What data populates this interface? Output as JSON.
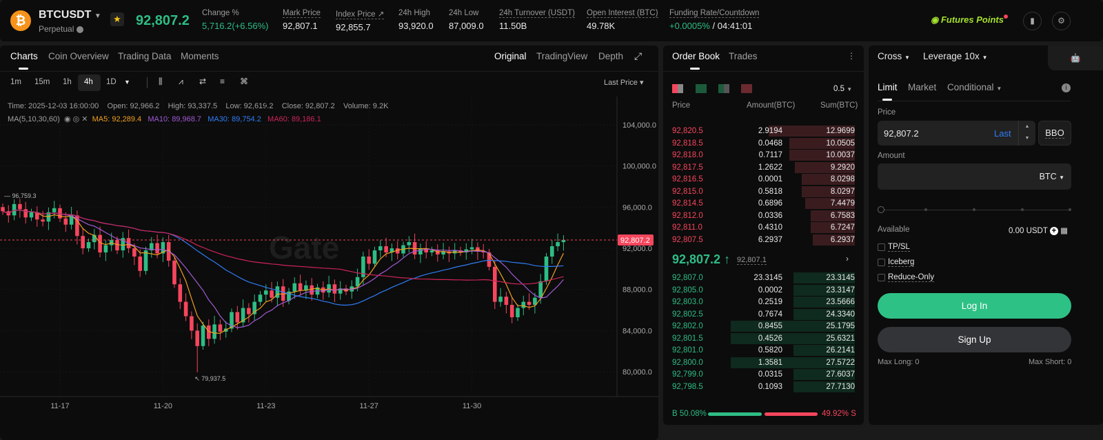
{
  "header": {
    "symbol": "BTCUSDT",
    "type": "Perpetual",
    "last_price": "92,807.2",
    "stats": [
      {
        "label": "Change %",
        "value": "5,716.2(+6.56%)"
      },
      {
        "label": "Mark Price",
        "value": "92,807.1"
      },
      {
        "label": "Index Price ↗",
        "value": "92,855.7"
      },
      {
        "label": "24h High",
        "value": "93,920.0"
      },
      {
        "label": "24h Low",
        "value": "87,009.0"
      },
      {
        "label": "24h Turnover (USDT)",
        "value": "11.50B"
      },
      {
        "label": "Open Interest (BTC)",
        "value": "49.78K"
      },
      {
        "label": "Funding Rate/Countdown",
        "value": "+0.0005%",
        "countdown": "/ 04:41:01"
      }
    ],
    "futures_points": "Futures Points"
  },
  "chart_tabs": [
    "Charts",
    "Coin Overview",
    "Trading Data",
    "Moments"
  ],
  "view_tabs": [
    "Original",
    "TradingView",
    "Depth"
  ],
  "intervals": [
    "1m",
    "15m",
    "1h",
    "4h",
    "1D"
  ],
  "price_type": "Last Price",
  "ohlc": "Time: 2025-12-03 16:00:00    Open: 92,966.2    High: 93,337.5    Low: 92,619.2    Close: 92,807.2    Volume: 9.2K",
  "ma": {
    "label": "MA(5,10,30,60)",
    "ma5": "MA5: 92,289.4",
    "ma10": "MA10: 89,968.7",
    "ma30": "MA30: 89,754.2",
    "ma60": "MA60: 89,186.1"
  },
  "watermark": "Gate",
  "chart_data": {
    "type": "candlestick",
    "unit": "thousand USDT",
    "y_ticks": [
      "104,000.0",
      "100,000.0",
      "96,000.0",
      "92,000.0",
      "88,000.0",
      "84,000.0",
      "80,000.0"
    ],
    "ylim": [
      80,
      104
    ],
    "x_ticks": [
      {
        "label": "11-17",
        "index": 10
      },
      {
        "label": "11-20",
        "index": 28
      },
      {
        "label": "11-23",
        "index": 46
      },
      {
        "label": "11-27",
        "index": 64
      },
      {
        "label": "11-30",
        "index": 82
      }
    ],
    "closes": [
      95.6,
      95.2,
      96.3,
      95.8,
      95.0,
      95.5,
      94.8,
      94.6,
      95.5,
      95.9,
      94.9,
      94.3,
      95.2,
      93.2,
      92.0,
      92.6,
      93.3,
      91.6,
      92.3,
      92.8,
      91.8,
      93.0,
      92.0,
      91.2,
      89.8,
      91.8,
      92.5,
      91.5,
      92.6,
      90.8,
      88.5,
      86.8,
      85.4,
      84.0,
      82.5,
      84.5,
      83.2,
      84.6,
      83.9,
      84.2,
      85.8,
      84.8,
      86.2,
      85.6,
      86.8,
      87.5,
      87.9,
      87.2,
      88.3,
      86.9,
      87.8,
      88.6,
      87.9,
      88.4,
      87.5,
      88.2,
      87.7,
      88.5,
      87.6,
      88.1,
      87.8,
      88.3,
      89.2,
      91.2,
      90.5,
      91.8,
      92.2,
      91.6,
      92.0,
      91.5,
      92.3,
      92.6,
      91.4,
      92.0,
      91.6,
      91.8,
      91.4,
      91.7,
      91.5,
      91.8,
      91.6,
      91.9,
      92.1,
      91.7,
      91.6,
      90.2,
      86.8,
      87.3,
      86.5,
      85.3,
      86.2,
      86.8,
      86.5,
      87.2,
      88.8,
      91.2,
      92.2,
      92.6,
      92.807
    ],
    "high_label": "96,759.3",
    "low_label": "79,937.5",
    "last_label": "92,807.2",
    "colors": {
      "up": "#2ebd85",
      "down": "#f6465d",
      "ma5": "#f0a020",
      "ma10": "#a25ad6",
      "ma30": "#2f7df6",
      "ma60": "#d0245a"
    }
  },
  "orderbook": {
    "tabs": [
      "Order Book",
      "Trades"
    ],
    "precision": "0.5",
    "cols": [
      "Price",
      "Amount(BTC)",
      "Sum(BTC)"
    ],
    "asks": [
      [
        "92,820.5",
        "2.9194",
        "12.9699"
      ],
      [
        "92,818.5",
        "0.0468",
        "10.0505"
      ],
      [
        "92,818.0",
        "0.7117",
        "10.0037"
      ],
      [
        "92,817.5",
        "1.2622",
        "9.2920"
      ],
      [
        "92,816.5",
        "0.0001",
        "8.0298"
      ],
      [
        "92,815.0",
        "0.5818",
        "8.0297"
      ],
      [
        "92,814.5",
        "0.6896",
        "7.4479"
      ],
      [
        "92,812.0",
        "0.0336",
        "6.7583"
      ],
      [
        "92,811.0",
        "0.4310",
        "6.7247"
      ],
      [
        "92,807.5",
        "6.2937",
        "6.2937"
      ]
    ],
    "asks_depth": [
      0.47,
      0.36,
      0.36,
      0.33,
      0.29,
      0.29,
      0.27,
      0.24,
      0.24,
      0.23
    ],
    "mid": "92,807.2",
    "mark": "92,807.1",
    "bids": [
      [
        "92,807.0",
        "23.3145",
        "23.3145"
      ],
      [
        "92,805.0",
        "0.0002",
        "23.3147"
      ],
      [
        "92,803.0",
        "0.2519",
        "23.5666"
      ],
      [
        "92,802.5",
        "0.7674",
        "24.3340"
      ],
      [
        "92,802.0",
        "0.8455",
        "25.1795"
      ],
      [
        "92,801.5",
        "0.4526",
        "25.6321"
      ],
      [
        "92,801.0",
        "0.5820",
        "26.2141"
      ],
      [
        "92,800.0",
        "1.3581",
        "27.5722"
      ],
      [
        "92,799.0",
        "0.0315",
        "27.6037"
      ],
      [
        "92,798.5",
        "0.1093",
        "27.7130"
      ]
    ],
    "buy": "B 50.08%",
    "sell": "49.92% S",
    "buy_pct": 50.08
  },
  "trade": {
    "margin": "Cross",
    "leverage": "Leverage 10x",
    "types": [
      "Limit",
      "Market",
      "Conditional"
    ],
    "price_label": "Price",
    "price": "92,807.2",
    "last": "Last",
    "bbo": "BBO",
    "amount_label": "Amount",
    "unit": "BTC",
    "available_label": "Available",
    "available": "0.00 USDT",
    "options": [
      "TP/SL",
      "Iceberg",
      "Reduce-Only"
    ],
    "login": "Log In",
    "signup": "Sign Up",
    "max_long": "Max Long: 0",
    "max_short": "Max Short: 0"
  }
}
